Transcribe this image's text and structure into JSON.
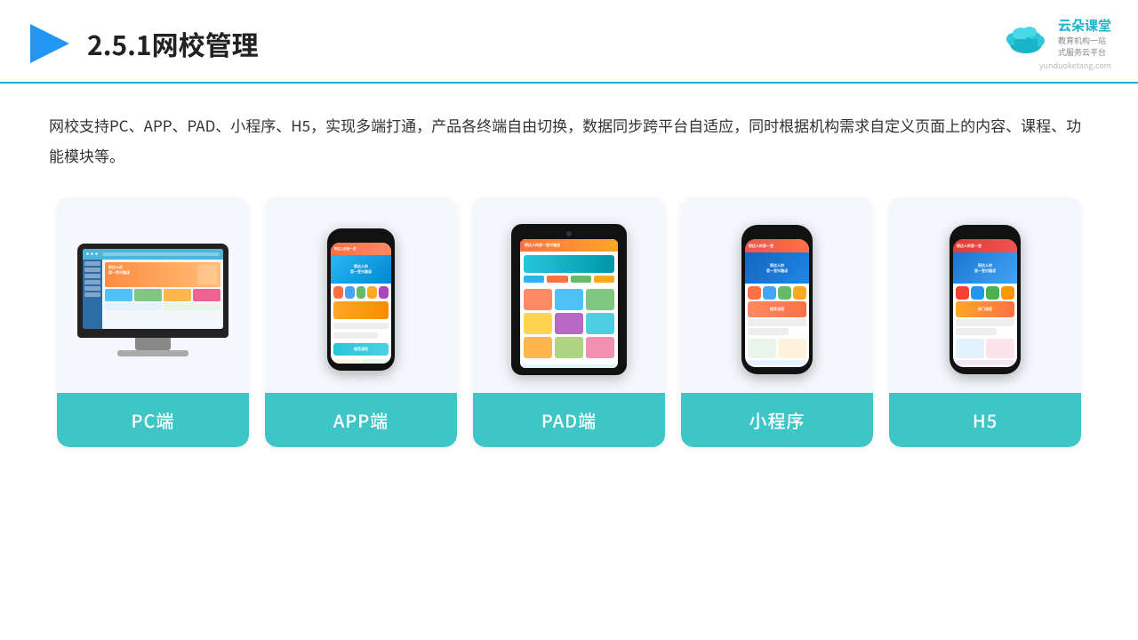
{
  "header": {
    "title": "2.5.1网校管理",
    "logo_name": "云朵课堂",
    "logo_url": "yunduoketang.com",
    "logo_tagline": "教育机构一站\n式服务云平台"
  },
  "description": "网校支持PC、APP、PAD、小程序、H5，实现多端打通，产品各终端自由切换，数据同步跨平台自适应，同时根据机构需求自定义页面上的内容、课程、功能模块等。",
  "cards": [
    {
      "id": "pc",
      "label": "PC端"
    },
    {
      "id": "app",
      "label": "APP端"
    },
    {
      "id": "pad",
      "label": "PAD端"
    },
    {
      "id": "miniprogram",
      "label": "小程序"
    },
    {
      "id": "h5",
      "label": "H5"
    }
  ],
  "colors": {
    "accent": "#3ec6c6",
    "header_line": "#1ab3c8",
    "play_color": "#2196f3"
  }
}
